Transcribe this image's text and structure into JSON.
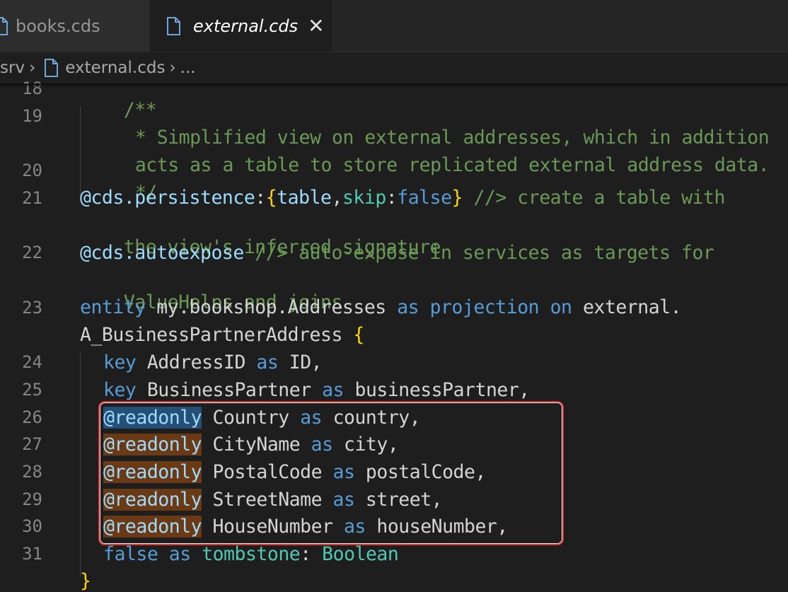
{
  "tabs": [
    {
      "label": "books.cds",
      "active": false,
      "icon": "file-icon"
    },
    {
      "label": "external.cds",
      "active": true,
      "icon": "file-icon",
      "close": "✕"
    }
  ],
  "breadcrumb": {
    "folder": "srv",
    "file": "external.cds",
    "more": "..."
  },
  "lines": [
    {
      "num": "18",
      "text": "/**"
    },
    {
      "num": "19",
      "text": " * Simplified view on external addresses, which in addition"
    },
    {
      "num": "",
      "text": " acts as a table to store replicated external address data."
    },
    {
      "num": "20",
      "text": " */"
    },
    {
      "num": "21",
      "text": "@cds.persistence:{table,skip:false} //> create a table with"
    },
    {
      "num": "",
      "text": "the view's inferred signature"
    },
    {
      "num": "22",
      "text": "@cds.autoexpose //> auto-expose in services as targets for"
    },
    {
      "num": "",
      "text": "ValueHelps and joins"
    },
    {
      "num": "23",
      "text": "entity my.bookshop.Addresses as projection on external."
    },
    {
      "num": "",
      "text": "A_BusinessPartnerAddress {"
    },
    {
      "num": "24",
      "text": "  key AddressID as ID,"
    },
    {
      "num": "25",
      "text": "  key BusinessPartner as businessPartner,"
    },
    {
      "num": "26",
      "text": "  @readonly Country as country,"
    },
    {
      "num": "27",
      "text": "  @readonly CityName as city,"
    },
    {
      "num": "28",
      "text": "  @readonly PostalCode as postalCode,"
    },
    {
      "num": "29",
      "text": "  @readonly StreetName as street,"
    },
    {
      "num": "30",
      "text": "  @readonly HouseNumber as houseNumber,"
    },
    {
      "num": "31",
      "text": "  false as tombstone: Boolean"
    }
  ],
  "tokens": {
    "l18": "/**",
    "l19": "* Simplified view on external addresses, which in addition",
    "l19b": "acts as a table to store replicated external address data.",
    "l20": "*/",
    "l21_ann": "@cds.persistence",
    "l21_colon": ":",
    "l21_open": "{",
    "l21_table": "table",
    "l21_comma": ",",
    "l21_skip": "skip",
    "l21_colon2": ":",
    "l21_false": "false",
    "l21_close": "}",
    "l21_comment": " //> create a table with",
    "l21b": "the view's inferred signature",
    "l22_ann": "@cds.autoexpose",
    "l22_comment": " //> auto-expose in services as targets for",
    "l22b": "ValueHelps and joins",
    "l23_entity": "entity",
    "l23_name": " my.bookshop.Addresses ",
    "l23_as": "as",
    "l23_sp1": " ",
    "l23_projection": "projection",
    "l23_sp2": " ",
    "l23_on": "on",
    "l23_ext": " external.",
    "l23b_name": "A_BusinessPartnerAddress ",
    "l23b_brace": "{",
    "l24_key": "key",
    "l24_a": " AddressID ",
    "l24_as": "as",
    "l24_b": " ID,",
    "l25_key": "key",
    "l25_a": " BusinessPartner ",
    "l25_as": "as",
    "l25_b": " businessPartner,",
    "ro": "@readonly",
    "l26_a": " Country ",
    "l26_b": " country,",
    "l27_a": " CityName ",
    "l27_b": " city,",
    "l28_a": " PostalCode ",
    "l28_b": " postalCode,",
    "l29_a": " StreetName ",
    "l29_b": " street,",
    "l30_a": " HouseNumber ",
    "l30_b": " houseNumber,",
    "as": "as",
    "l31_false": "false",
    "l31_as": "as",
    "l31_tomb": "tombstone",
    "l31_colon": ": ",
    "l31_type": "Boolean"
  },
  "colors": {
    "editor_bg": "#1e1e1e",
    "comment": "#6a9955",
    "keyword": "#569cd6",
    "annotation": "#9cdcfe",
    "type": "#4ec9b0",
    "highlight_box": "#e53030",
    "readonly_highlight": "#6b3a15",
    "selection": "#264f78"
  }
}
